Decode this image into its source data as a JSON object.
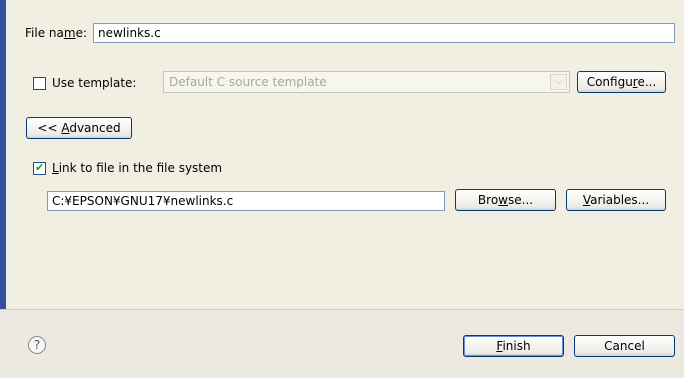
{
  "file_name": {
    "label_pre": "File na",
    "label_mnemonic": "m",
    "label_post": "e:",
    "value": "newlinks.c"
  },
  "use_template": {
    "checked": false,
    "label": "Use template:",
    "combo_value": "Default C source template",
    "configure_pre": "Configu",
    "configure_mnemonic": "r",
    "configure_post": "e..."
  },
  "advanced_button": {
    "prefix": "<< ",
    "mnemonic": "A",
    "rest": "dvanced"
  },
  "link": {
    "checked": true,
    "mnemonic": "L",
    "label_rest": "ink to file in the file system",
    "path_value": "C:¥EPSON¥GNU17¥newlinks.c",
    "browse_pre": "Bro",
    "browse_mnemonic": "w",
    "browse_post": "se...",
    "variables_mnemonic": "V",
    "variables_rest": "ariables..."
  },
  "footer": {
    "help_glyph": "?",
    "finish_mnemonic": "F",
    "finish_rest": "inish",
    "cancel_label": "Cancel"
  },
  "colors": {
    "dialog_bg": "#f1efe2",
    "accent": "#33509e",
    "button_border": "#003c74",
    "check_green": "#21a121"
  }
}
